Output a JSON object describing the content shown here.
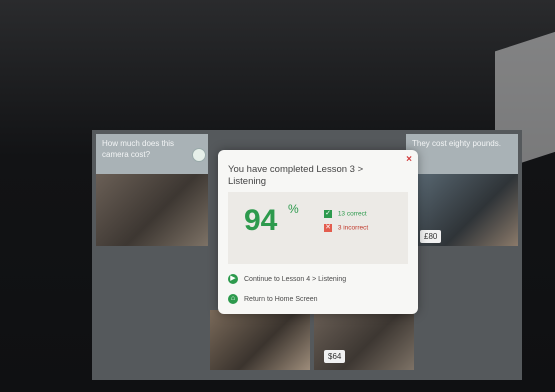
{
  "background_cards": [
    {
      "prompt": "How much does this camera cost?"
    },
    {
      "prompt": "They cost eighty pounds."
    }
  ],
  "price_tags": [
    "£80",
    "$64"
  ],
  "dialog": {
    "title": "You have completed Lesson 3 > Listening",
    "score_value": "94",
    "score_percent": "%",
    "correct": "13 correct",
    "incorrect": "3 incorrect",
    "continue_label": "Continue to Lesson 4 > Listening",
    "home_label": "Return to Home Screen",
    "close_symbol": "×"
  },
  "colors": {
    "accent_green": "#2d9a4d",
    "error_red": "#d23a3a",
    "dialog_bg": "#f7f7f5"
  },
  "icons": {
    "correct": "check-icon",
    "incorrect": "cross-icon",
    "continue": "play-icon",
    "home": "home-icon",
    "audio": "speaker-icon"
  }
}
